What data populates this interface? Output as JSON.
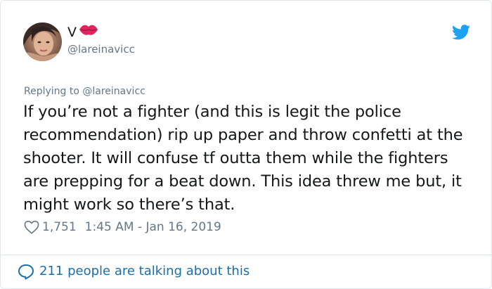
{
  "author": {
    "display_name": "V",
    "emoji_icon": "kiss-lips-icon",
    "handle": "@lareinavicc"
  },
  "reply": {
    "prefix": "Replying to",
    "to": "@lareinavicc"
  },
  "tweet": {
    "text": "If you’re not a fighter (and this is legit the police recommendation) rip up paper and throw confetti at the shooter. It will confuse tf outta them while the fighters are prepping for a beat down. This idea threw me but, it might work so there’s that.",
    "like_count": "1,751",
    "timestamp": "1:45 AM - Jan 16, 2019"
  },
  "footer": {
    "talking": "211 people are talking about this"
  },
  "colors": {
    "twitter_blue": "#1da1f2",
    "link_blue": "#1b6fa8",
    "muted": "#657786",
    "lips_red": "#e0245e"
  }
}
